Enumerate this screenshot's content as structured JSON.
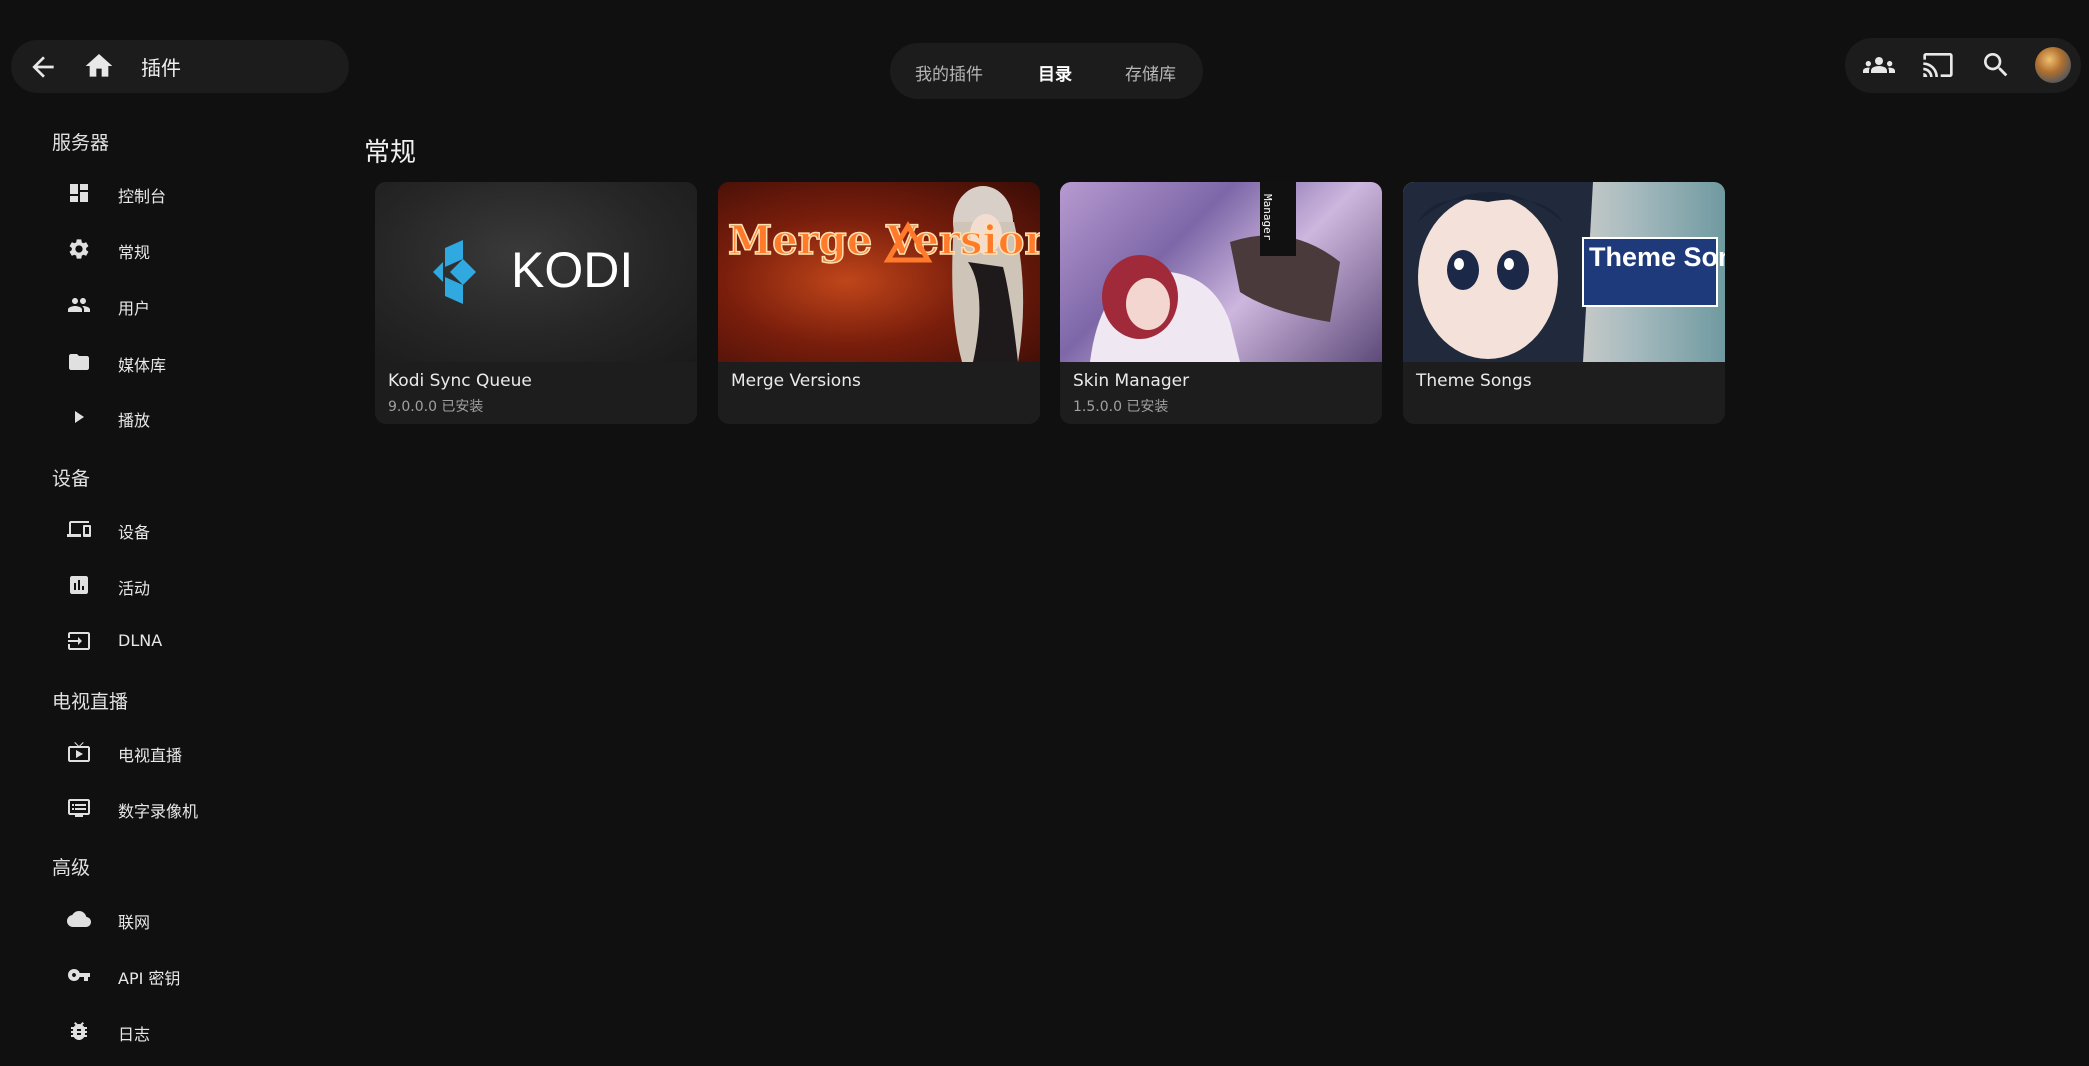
{
  "header": {
    "title": "插件",
    "tabs": [
      {
        "label": "我的插件",
        "active": false
      },
      {
        "label": "目录",
        "active": true
      },
      {
        "label": "存储库",
        "active": false
      }
    ],
    "icons": [
      "back-arrow-icon",
      "home-icon",
      "users-icon",
      "cast-icon",
      "search-icon",
      "avatar"
    ]
  },
  "sidebar": {
    "sections": [
      {
        "heading": "服务器",
        "items": [
          {
            "label": "控制台",
            "icon": "dashboard-icon"
          },
          {
            "label": "常规",
            "icon": "gear-icon"
          },
          {
            "label": "用户",
            "icon": "users-icon"
          },
          {
            "label": "媒体库",
            "icon": "folder-icon"
          },
          {
            "label": "播放",
            "icon": "play-icon"
          }
        ]
      },
      {
        "heading": "设备",
        "items": [
          {
            "label": "设备",
            "icon": "devices-icon"
          },
          {
            "label": "活动",
            "icon": "activity-icon"
          },
          {
            "label": "DLNA",
            "icon": "input-icon"
          }
        ]
      },
      {
        "heading": "电视直播",
        "items": [
          {
            "label": "电视直播",
            "icon": "live-tv-icon"
          },
          {
            "label": "数字录像机",
            "icon": "dvr-icon"
          }
        ]
      },
      {
        "heading": "高级",
        "items": [
          {
            "label": "联网",
            "icon": "cloud-icon"
          },
          {
            "label": "API 密钥",
            "icon": "key-icon"
          },
          {
            "label": "日志",
            "icon": "bug-icon"
          }
        ]
      }
    ]
  },
  "main": {
    "section_title": "常规",
    "plugins": [
      {
        "name": "Kodi Sync Queue",
        "version": "9.0.0.0 已安装",
        "thumb_text": "KODI"
      },
      {
        "name": "Merge Versions",
        "version": "",
        "thumb_text": "Merge Versions"
      },
      {
        "name": "Skin Manager",
        "version": "1.5.0.0 已安装",
        "thumb_text": "Manager"
      },
      {
        "name": "Theme Songs",
        "version": "",
        "thumb_text": "Theme Songs"
      }
    ]
  },
  "colors": {
    "background": "#101010",
    "surface": "#1c1c1c",
    "card": "#1d1d1d",
    "kodi_blue": "#2fa9e0"
  }
}
